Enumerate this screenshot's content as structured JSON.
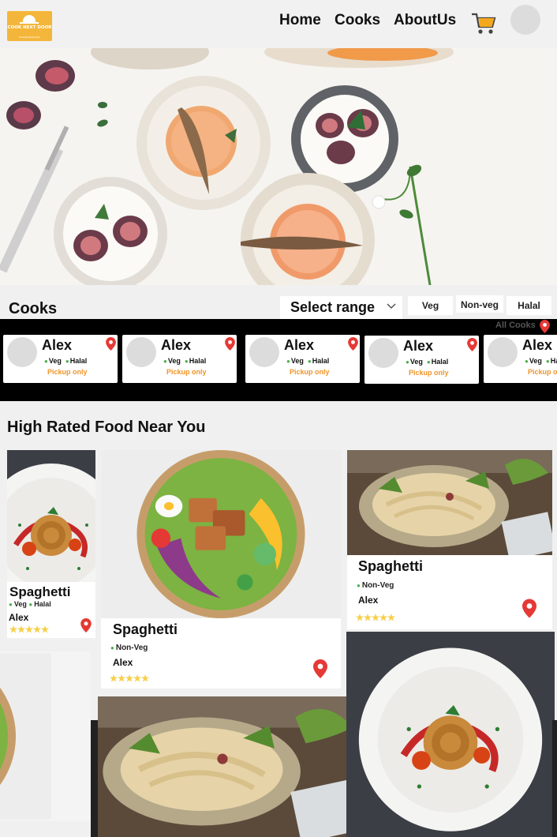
{
  "nav": {
    "logo_text": "COOK NEXT DOOR",
    "logo_sub": "Cooking Made Easy",
    "links": [
      "Home",
      "Cooks",
      "AboutUs"
    ]
  },
  "cooks_section": {
    "title": "Cooks",
    "range_label": "Select range",
    "filters": [
      "Veg",
      "Non-veg",
      "Halal"
    ],
    "all_cooks_label": "All Cooks",
    "cards": [
      {
        "name": "Alex",
        "tag1": "Veg",
        "tag2": "Halal",
        "pickup": "Pickup only"
      },
      {
        "name": "Alex",
        "tag1": "Veg",
        "tag2": "Halal",
        "pickup": "Pickup only"
      },
      {
        "name": "Alex",
        "tag1": "Veg",
        "tag2": "Halal",
        "pickup": "Pickup only"
      },
      {
        "name": "Alex",
        "tag1": "Veg",
        "tag2": "Halal",
        "pickup": "Pickup only"
      },
      {
        "name": "Alex",
        "tag1": "Veg",
        "tag2": "Halal",
        "pickup": "Pickup only"
      }
    ]
  },
  "food_section": {
    "title": "High Rated Food Near You",
    "cards": [
      {
        "name": "Spaghetti",
        "tag1": "Veg",
        "tag2": "Halal",
        "cook": "Alex",
        "rating": 5
      },
      {
        "name": "Spaghetti",
        "tag1": "Non-Veg",
        "cook": "Alex",
        "rating": 5
      },
      {
        "name": "Spaghetti",
        "tag1": "Non-Veg",
        "cook": "Alex",
        "rating": 5
      }
    ]
  },
  "colors": {
    "brand": "#f4b63a",
    "pickup": "#f0942a",
    "pin": "#e53935",
    "star": "#f6d04d",
    "dot": "#4caf50"
  }
}
